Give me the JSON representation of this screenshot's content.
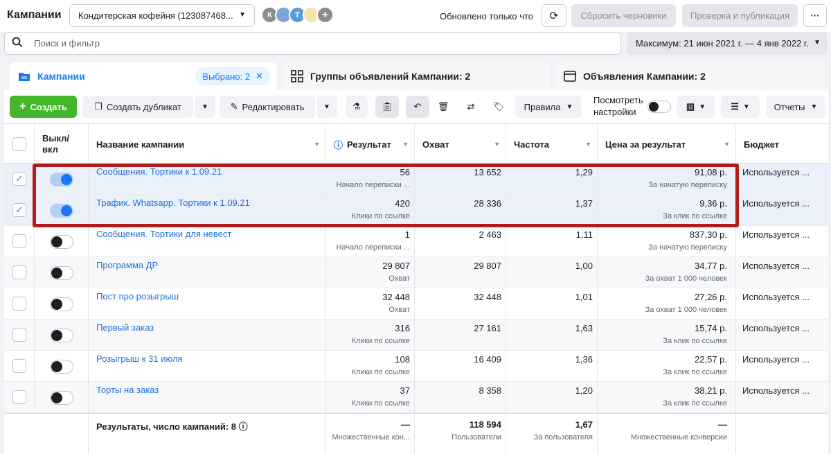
{
  "topbar": {
    "title": "Кампании",
    "account": "Кондитерская кофейня (123087468...",
    "avatars": [
      "К",
      "Т"
    ],
    "updated": "Обновлено только что",
    "reset_drafts": "Сбросить черновики",
    "review_publish": "Проверка и публикация",
    "more": "···"
  },
  "search": {
    "placeholder": "Поиск и фильтр"
  },
  "date_range": "Максимум: 21 июн 2021 г. — 4 янв 2022 г.",
  "tabs": {
    "campaigns": "Кампании",
    "selected": "Выбрано: 2",
    "adsets": "Группы объявлений Кампании: 2",
    "ads": "Объявления Кампании: 2"
  },
  "toolbar": {
    "create": "Создать",
    "duplicate": "Создать дубликат",
    "edit": "Редактировать",
    "rules": "Правила",
    "view_settings_1": "Посмотреть",
    "view_settings_2": "настройки",
    "reports": "Отчеты"
  },
  "columns": {
    "onoff_1": "Выкл/",
    "onoff_2": "вкл",
    "name": "Название кампании",
    "result": "Результат",
    "reach": "Охват",
    "frequency": "Частота",
    "cost": "Цена за результат",
    "budget": "Бюджет"
  },
  "rows": [
    {
      "checked": true,
      "on": true,
      "name": "Сообщения. Тортики к 1.09.21",
      "result": "56",
      "result_type": "Начало переписки ...",
      "reach": "13 652",
      "frequency": "1,29",
      "cost": "91,08 р.",
      "cost_type": "За начатую переписку",
      "budget": "Используется ..."
    },
    {
      "checked": true,
      "on": true,
      "name": "Трафик. Whatsapp. Тортики к 1.09.21",
      "result": "420",
      "result_type": "Клики по ссылке",
      "reach": "28 336",
      "frequency": "1,37",
      "cost": "9,36 р.",
      "cost_type": "За клик по ссылке",
      "budget": "Используется ..."
    },
    {
      "checked": false,
      "on": false,
      "name": "Сообщения. Тортики для невест",
      "result": "1",
      "result_type": "Начало переписки ...",
      "reach": "2 463",
      "frequency": "1,11",
      "cost": "837,30 р.",
      "cost_type": "За начатую переписку",
      "budget": "Используется ..."
    },
    {
      "checked": false,
      "on": false,
      "name": "Программа ДР",
      "result": "29 807",
      "result_type": "Охват",
      "reach": "29 807",
      "frequency": "1,00",
      "cost": "34,77 р.",
      "cost_type": "За охват 1 000 человек",
      "budget": "Используется ..."
    },
    {
      "checked": false,
      "on": false,
      "name": "Пост про розыгрыш",
      "result": "32 448",
      "result_type": "Охват",
      "reach": "32 448",
      "frequency": "1,01",
      "cost": "27,26 р.",
      "cost_type": "За охват 1 000 человек",
      "budget": "Используется ..."
    },
    {
      "checked": false,
      "on": false,
      "name": "Первый заказ",
      "result": "316",
      "result_type": "Клики по ссылке",
      "reach": "27 161",
      "frequency": "1,63",
      "cost": "15,74 р.",
      "cost_type": "За клик по ссылке",
      "budget": "Используется ..."
    },
    {
      "checked": false,
      "on": false,
      "name": "Розыгрыш к 31 июля",
      "result": "108",
      "result_type": "Клики по ссылке",
      "reach": "16 409",
      "frequency": "1,36",
      "cost": "22,57 р.",
      "cost_type": "За клик по ссылке",
      "budget": "Используется ..."
    },
    {
      "checked": false,
      "on": false,
      "name": "Торты на заказ",
      "result": "37",
      "result_type": "Клики по ссылке",
      "reach": "8 358",
      "frequency": "1,20",
      "cost": "38,21 р.",
      "cost_type": "За клик по ссылке",
      "budget": "Используется ..."
    }
  ],
  "totals": {
    "label": "Результаты, число кампаний: 8",
    "result": "—",
    "result_type": "Множественные кон...",
    "reach": "118 594",
    "reach_type": "Пользователи",
    "frequency": "1,67",
    "frequency_type": "За пользователя",
    "cost": "—",
    "cost_type": "Множественные конверсии"
  },
  "colors": {
    "accent": "#1877f2",
    "create": "#42b72a",
    "highlight": "#b41a1a"
  }
}
